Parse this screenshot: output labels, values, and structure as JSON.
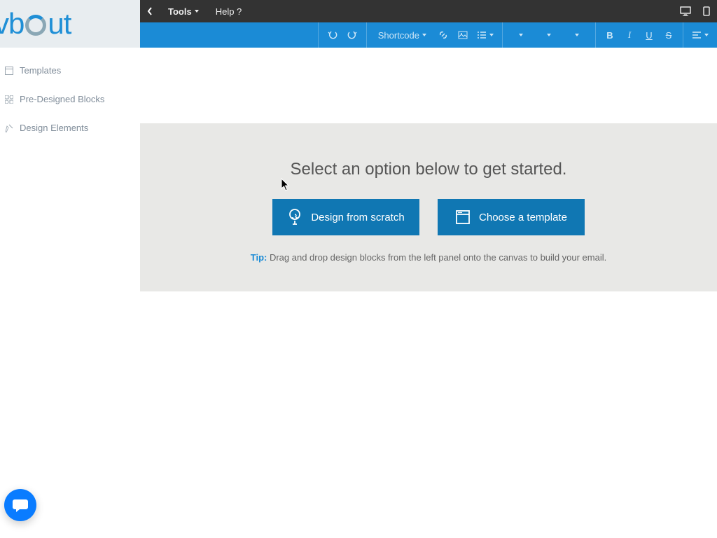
{
  "logo": {
    "text_left": "vb",
    "text_right": "ut"
  },
  "sidebar": {
    "items": [
      {
        "label": "Templates"
      },
      {
        "label": "Pre-Designed Blocks"
      },
      {
        "label": "Design Elements"
      }
    ]
  },
  "topbar": {
    "tools": "Tools",
    "help": "Help ?"
  },
  "ribbon": {
    "shortcode": "Shortcode",
    "bold": "B",
    "italic": "I",
    "underline": "U",
    "strike": "S"
  },
  "starter": {
    "title": "Select an option below to get started.",
    "scratch": "Design from scratch",
    "template": "Choose a template",
    "tip_label": "Tip:",
    "tip_text": " Drag and drop design blocks from the left panel onto the canvas to build your email."
  }
}
